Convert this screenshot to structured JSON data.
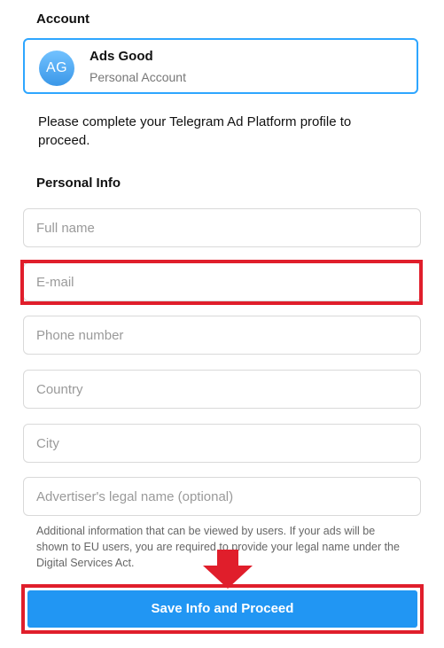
{
  "account": {
    "section_title": "Account",
    "avatar_initials": "AG",
    "name": "Ads Good",
    "type": "Personal Account"
  },
  "intro_text": "Please complete your Telegram Ad Platform profile to proceed.",
  "personal_info": {
    "section_title": "Personal Info",
    "fields": {
      "full_name": {
        "placeholder": "Full name",
        "value": ""
      },
      "email": {
        "placeholder": "E-mail",
        "value": ""
      },
      "phone": {
        "placeholder": "Phone number",
        "value": ""
      },
      "country": {
        "placeholder": "Country",
        "value": ""
      },
      "city": {
        "placeholder": "City",
        "value": ""
      },
      "legal_name": {
        "placeholder": "Advertiser's legal name (optional)",
        "value": ""
      }
    },
    "hint": "Additional information that can be viewed by users. If your ads will be shown to EU users, you are required to provide your legal name under the Digital Services Act."
  },
  "save_button_label": "Save Info and Proceed",
  "colors": {
    "accent": "#2196f3",
    "card_border": "#2ea6ff",
    "highlight": "#e01e2b"
  }
}
